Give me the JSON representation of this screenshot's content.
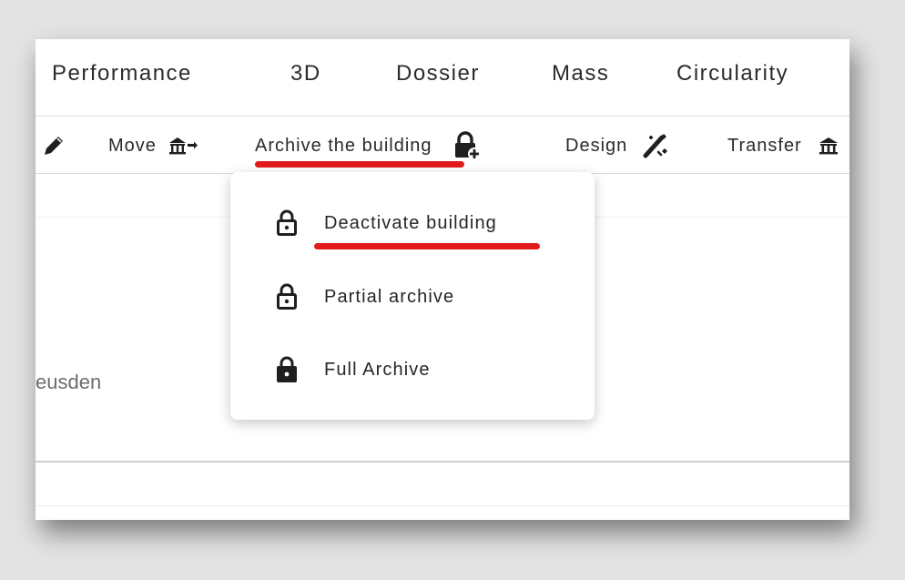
{
  "tabs": [
    "Performance",
    "3D",
    "Dossier",
    "Mass",
    "Circularity"
  ],
  "toolbar": {
    "edit_icon": "pencil-icon",
    "move_label": "Move",
    "move_icon": "building-arrows-icon",
    "archive_label": "Archive the building",
    "archive_icon": "lock-plus-icon",
    "design_label": "Design",
    "design_icon": "magic-wand-icon",
    "transfer_label": "Transfer",
    "transfer_icon": "building-icon"
  },
  "content": {
    "city_fragment": "eusden"
  },
  "dropdown": {
    "items": [
      {
        "label": "Deactivate building",
        "icon": "lock-open-outline-icon"
      },
      {
        "label": "Partial archive",
        "icon": "lock-outline-icon"
      },
      {
        "label": "Full Archive",
        "icon": "lock-filled-icon"
      }
    ]
  },
  "colors": {
    "highlight": "#e11b1b",
    "text": "#2b2b2b",
    "muted": "#6d6d6d",
    "background": "#e3e3e3"
  }
}
